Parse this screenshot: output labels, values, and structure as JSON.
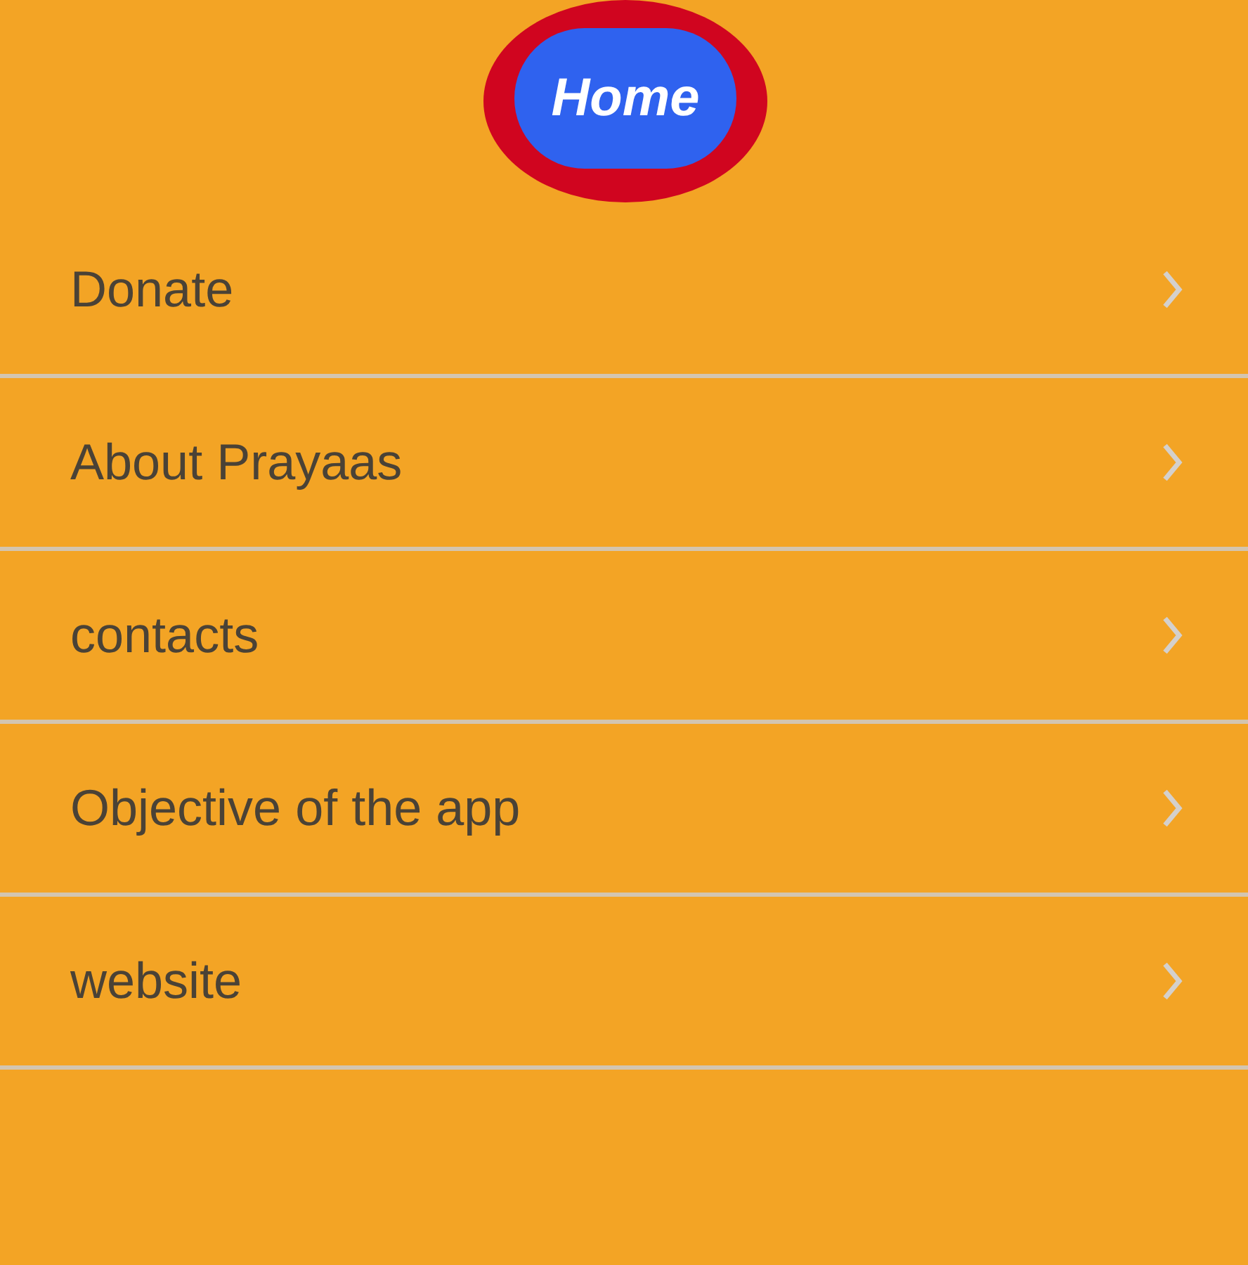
{
  "home_button": {
    "label": "Home"
  },
  "menu_items": [
    {
      "label": "Donate"
    },
    {
      "label": "About Prayaas"
    },
    {
      "label": "contacts"
    },
    {
      "label": "Objective of the app"
    },
    {
      "label": "website"
    }
  ]
}
